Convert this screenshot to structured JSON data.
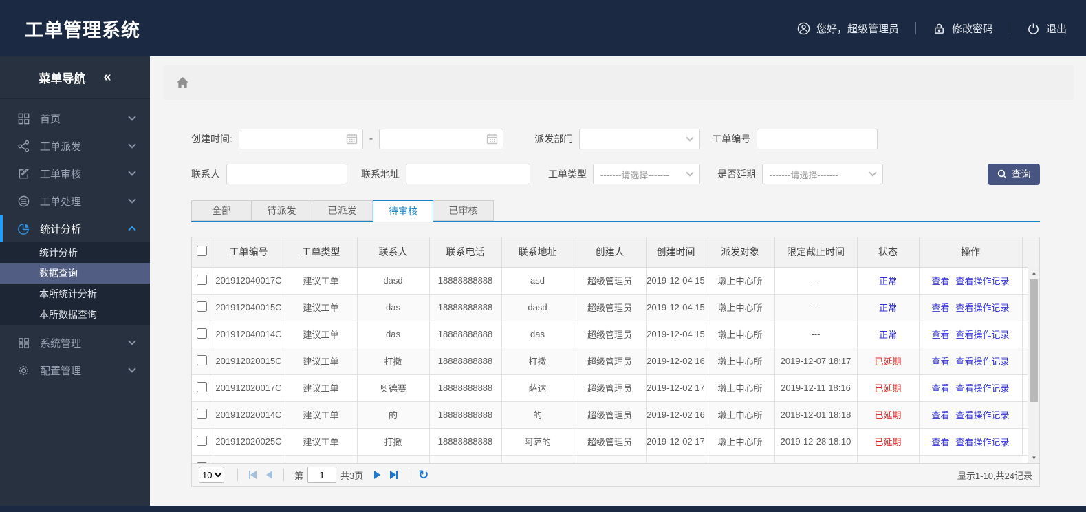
{
  "header": {
    "title": "工单管理系统",
    "greeting": "您好，超级管理员",
    "change_password": "修改密码",
    "logout": "退出"
  },
  "sidebar": {
    "nav_title": "菜单导航",
    "collapse_glyph": "«",
    "items": [
      {
        "label": "首页"
      },
      {
        "label": "工单派发"
      },
      {
        "label": "工单审核"
      },
      {
        "label": "工单处理"
      },
      {
        "label": "统计分析",
        "active": true,
        "children": [
          "统计分析",
          "数据查询",
          "本所统计分析",
          "本所数据查询"
        ],
        "active_child": "数据查询"
      },
      {
        "label": "系统管理"
      },
      {
        "label": "配置管理"
      }
    ]
  },
  "filters": {
    "create_time_label": "创建时间:",
    "create_time_from": "",
    "create_time_to": "",
    "range_separator": "-",
    "dispatch_dept_label": "派发部门",
    "dispatch_dept_value": "",
    "order_no_label": "工单编号",
    "order_no_value": "",
    "contact_label": "联系人",
    "contact_value": "",
    "address_label": "联系地址",
    "address_value": "",
    "order_type_label": "工单类型",
    "order_type_value": "-------请选择-------",
    "delay_label": "是否延期",
    "delay_value": "-------请选择-------",
    "search_button": "查询"
  },
  "tabs": {
    "items": [
      "全部",
      "待派发",
      "已派发",
      "待审核",
      "已审核"
    ],
    "active": "待审核"
  },
  "table": {
    "columns": [
      "工单编号",
      "工单类型",
      "联系人",
      "联系电话",
      "联系地址",
      "创建人",
      "创建时间",
      "派发对象",
      "限定截止时间",
      "状态",
      "操作"
    ],
    "action_links": [
      "查看",
      "查看操作记录"
    ],
    "colors": {
      "link": "#3333d6",
      "status_normal": "#3030d9",
      "status_delayed": "#e12b2b"
    },
    "rows": [
      {
        "order_no": "201912040017C",
        "type": "建议工单",
        "contact": "dasd",
        "phone": "18888888888",
        "address": "asd",
        "creator": "超级管理员",
        "created": "2019-12-04 15",
        "target": "墩上中心所",
        "deadline": "---",
        "status": "正常",
        "status_type": "normal"
      },
      {
        "order_no": "201912040015C",
        "type": "建议工单",
        "contact": "das",
        "phone": "18888888888",
        "address": "dasd",
        "creator": "超级管理员",
        "created": "2019-12-04 15",
        "target": "墩上中心所",
        "deadline": "---",
        "status": "正常",
        "status_type": "normal"
      },
      {
        "order_no": "201912040014C",
        "type": "建议工单",
        "contact": "das",
        "phone": "18888888888",
        "address": "das",
        "creator": "超级管理员",
        "created": "2019-12-04 15",
        "target": "墩上中心所",
        "deadline": "---",
        "status": "正常",
        "status_type": "normal"
      },
      {
        "order_no": "201912020015C",
        "type": "建议工单",
        "contact": "打撒",
        "phone": "18888888888",
        "address": "打撒",
        "creator": "超级管理员",
        "created": "2019-12-02 16",
        "target": "墩上中心所",
        "deadline": "2019-12-07 18:17",
        "status": "已延期",
        "status_type": "delayed"
      },
      {
        "order_no": "201912020017C",
        "type": "建议工单",
        "contact": "奥德赛",
        "phone": "18888888888",
        "address": "萨达",
        "creator": "超级管理员",
        "created": "2019-12-02 17",
        "target": "墩上中心所",
        "deadline": "2019-12-11 18:16",
        "status": "已延期",
        "status_type": "delayed"
      },
      {
        "order_no": "201912020014C",
        "type": "建议工单",
        "contact": "的",
        "phone": "18888888888",
        "address": "的",
        "creator": "超级管理员",
        "created": "2019-12-02 16",
        "target": "墩上中心所",
        "deadline": "2018-12-01 18:18",
        "status": "已延期",
        "status_type": "delayed"
      },
      {
        "order_no": "201912020025C",
        "type": "建议工单",
        "contact": "打撒",
        "phone": "18888888888",
        "address": "阿萨的",
        "creator": "超级管理员",
        "created": "2019-12-02 17",
        "target": "墩上中心所",
        "deadline": "2019-12-28 18:10",
        "status": "已延期",
        "status_type": "delayed"
      }
    ]
  },
  "pagination": {
    "page_size": "10",
    "page_prefix": "第",
    "page_value": "1",
    "total_pages": "共3页",
    "refresh_glyph": "↻",
    "scroll_up_glyph": "▲",
    "scroll_down_glyph": "▼",
    "summary": "显示1-10,共24记录"
  }
}
